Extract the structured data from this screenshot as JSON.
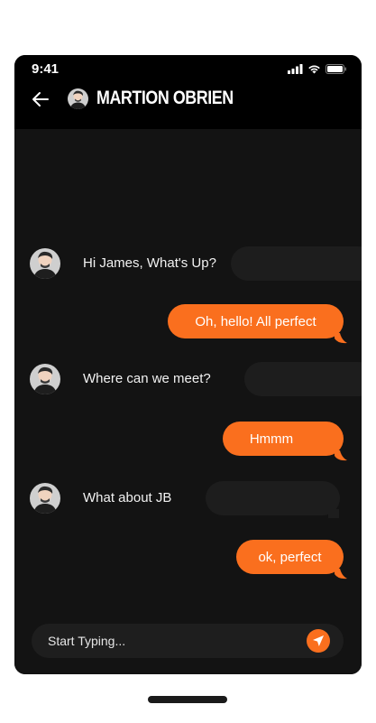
{
  "status_bar": {
    "time": "9:41"
  },
  "header": {
    "contact_name": "MARTION OBRIEN",
    "back_icon": "arrow-left-icon"
  },
  "messages": [
    {
      "from": "them",
      "text": "Hi James, What's Up?"
    },
    {
      "from": "me",
      "text": "Oh, hello! All perfect"
    },
    {
      "from": "them",
      "text": "Where can we meet?"
    },
    {
      "from": "me",
      "text": "Hmmm"
    },
    {
      "from": "them",
      "text": "What about JB"
    },
    {
      "from": "me",
      "text": "ok, perfect"
    }
  ],
  "composer": {
    "placeholder": "Start Typing...",
    "send_icon": "send-arrow-icon"
  },
  "colors": {
    "accent": "#fa6f1e",
    "background": "#131313",
    "header": "#000000"
  }
}
